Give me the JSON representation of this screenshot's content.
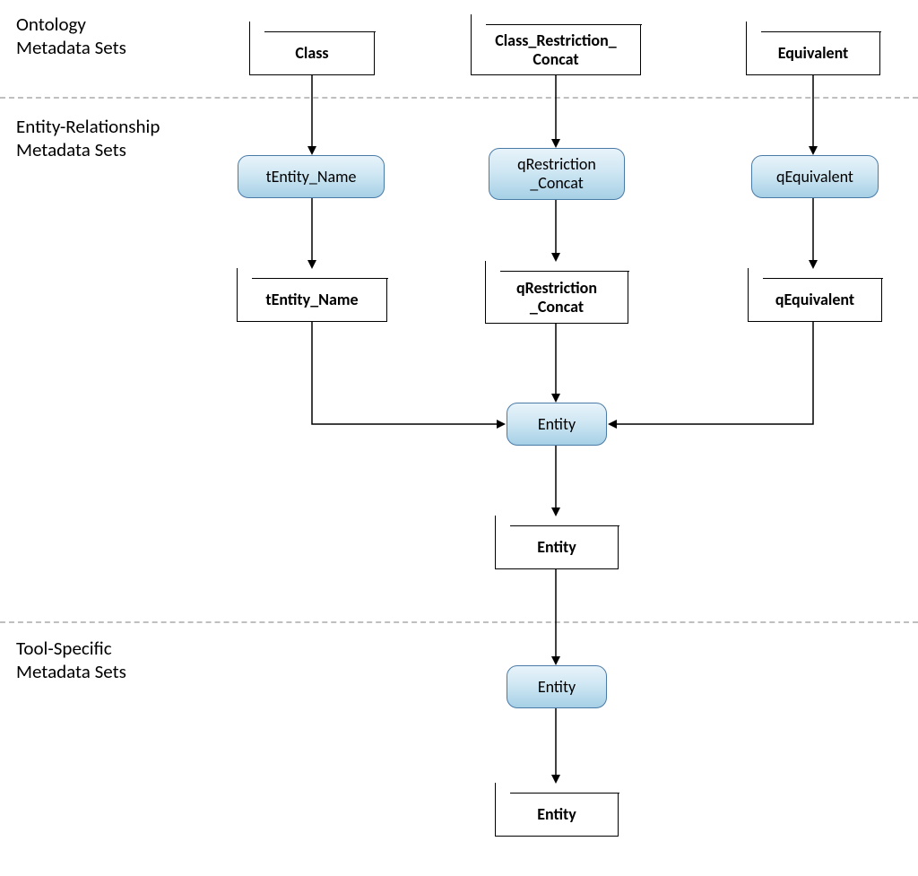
{
  "sections": {
    "ontology": "Ontology\nMetadata Sets",
    "er": "Entity-Relationship\nMetadata Sets",
    "tool": "Tool-Specific\nMetadata Sets"
  },
  "boxes": {
    "class": "Class",
    "class_restriction_concat": "Class_Restriction_\nConcat",
    "equivalent": "Equivalent",
    "tentity_name": "tEntity_Name",
    "qrestriction_concat": "qRestriction\n_Concat",
    "qequivalent": "qEquivalent",
    "entity_mid": "Entity",
    "entity_low": "Entity"
  },
  "nodes": {
    "tentity_name": "tEntity_Name",
    "qrestriction_concat": "qRestriction\n_Concat",
    "qequivalent": "qEquivalent",
    "entity_mid": "Entity",
    "entity_tool": "Entity"
  }
}
